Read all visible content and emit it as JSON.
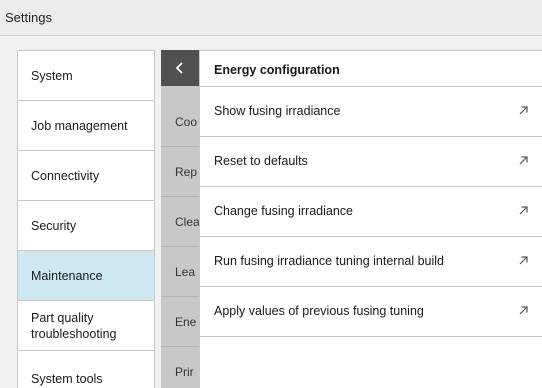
{
  "window": {
    "title": "Settings"
  },
  "sidebar": {
    "items": [
      {
        "label": "System",
        "selected": false
      },
      {
        "label": "Job management",
        "selected": false
      },
      {
        "label": "Connectivity",
        "selected": false
      },
      {
        "label": "Security",
        "selected": false
      },
      {
        "label": "Maintenance",
        "selected": true
      },
      {
        "label": "Part quality troubleshooting",
        "selected": false
      },
      {
        "label": "System tools",
        "selected": false
      }
    ]
  },
  "submenu": {
    "back_icon": "chevron-left-icon",
    "items": [
      {
        "label": "Coo"
      },
      {
        "label": "Rep"
      },
      {
        "label": "Clea"
      },
      {
        "label": "Lea"
      },
      {
        "label": "Ene"
      },
      {
        "label": "Prir"
      }
    ]
  },
  "panel": {
    "title": "Energy configuration",
    "options": [
      {
        "label": "Show fusing irradiance",
        "icon": "arrow-up-right-icon"
      },
      {
        "label": "Reset to defaults",
        "icon": "arrow-up-right-icon"
      },
      {
        "label": "Change fusing irradiance",
        "icon": "arrow-up-right-icon"
      },
      {
        "label": "Run fusing irradiance tuning internal build",
        "icon": "arrow-up-right-icon"
      },
      {
        "label": "Apply values of previous fusing tuning",
        "icon": "arrow-up-right-icon"
      }
    ]
  },
  "colors": {
    "selected_bg": "#cde8f2",
    "back_button_bg": "#505050",
    "submenu_bg": "#c8c8c8"
  }
}
